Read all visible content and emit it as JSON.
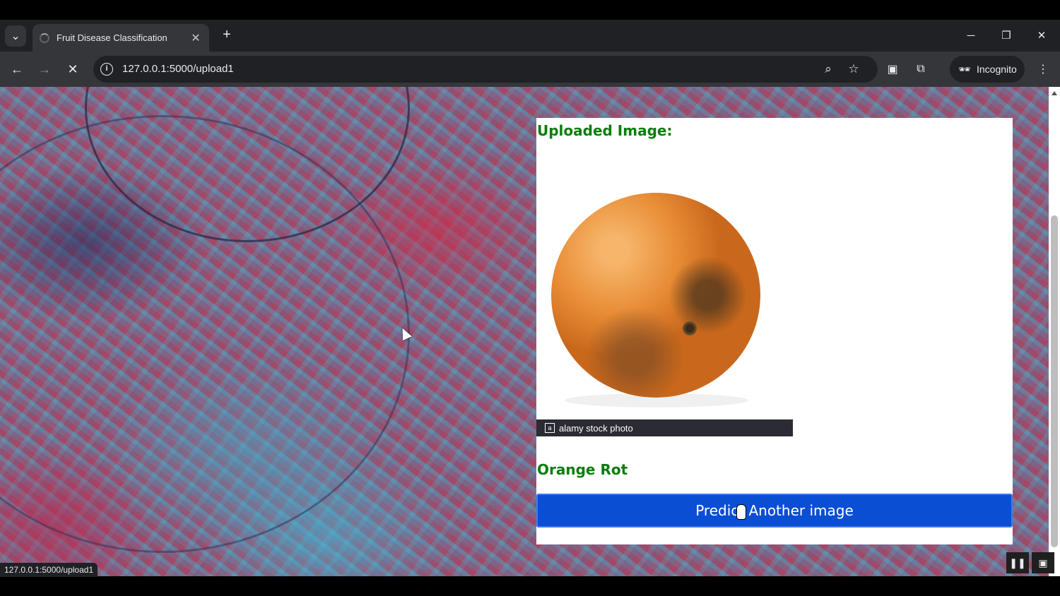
{
  "browser": {
    "tab_title": "Fruit Disease Classification",
    "url": "127.0.0.1:5000/upload1",
    "incognito_label": "Incognito",
    "status_url": "127.0.0.1:5000/upload1"
  },
  "page": {
    "heading": "Uploaded Image:",
    "watermark_text": "alamy stock photo",
    "result": "Orange Rot",
    "button_label": "Predict Another image"
  },
  "colors": {
    "heading_green": "#0b7d0b",
    "button_blue": "#0a4ed4",
    "tab_bar": "#202124",
    "toolbar": "#35363a"
  },
  "icons": [
    "tab-list-icon",
    "loading-spinner-icon",
    "close-icon",
    "plus-icon",
    "minimize-icon",
    "restore-icon",
    "back-icon",
    "forward-icon",
    "stop-icon",
    "info-icon",
    "zoom-icon",
    "star-icon",
    "profile-icon",
    "extensions-icon",
    "incognito-icon",
    "menu-icon",
    "pause-icon",
    "picture-in-picture-icon"
  ]
}
